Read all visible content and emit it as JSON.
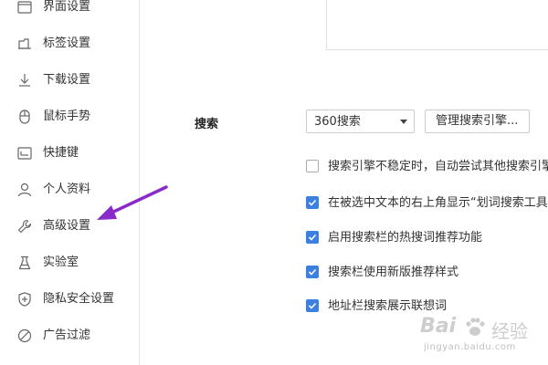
{
  "sidebar": {
    "items": [
      {
        "label": "界面设置",
        "icon": "window-icon"
      },
      {
        "label": "标签设置",
        "icon": "tab-icon"
      },
      {
        "label": "下载设置",
        "icon": "download-icon"
      },
      {
        "label": "鼠标手势",
        "icon": "mouse-icon"
      },
      {
        "label": "快捷键",
        "icon": "keyboard-icon"
      },
      {
        "label": "个人资料",
        "icon": "person-icon"
      },
      {
        "label": "高级设置",
        "icon": "wrench-icon"
      },
      {
        "label": "实验室",
        "icon": "flask-icon"
      },
      {
        "label": "隐私安全设置",
        "icon": "shield-plus-icon"
      },
      {
        "label": "广告过滤",
        "icon": "block-icon"
      }
    ]
  },
  "search": {
    "section_label": "搜索",
    "engine_value": "360搜索",
    "manage_button": "管理搜索引擎...",
    "options": [
      {
        "label": "搜索引擎不稳定时，自动尝试其他搜索引擎",
        "checked": false
      },
      {
        "label": "在被选中文本的右上角显示“划词搜索工具条”",
        "checked": true
      },
      {
        "label": "启用搜索栏的热搜词推荐功能",
        "checked": true
      },
      {
        "label": "搜索栏使用新版推荐样式",
        "checked": true
      },
      {
        "label": "地址栏搜索展示联想词",
        "checked": true
      }
    ]
  },
  "annotation": {
    "color": "#8a2bc9"
  },
  "watermark": {
    "logo": "Bai",
    "suffix": "经验",
    "url": "jingyan.baidu.com"
  },
  "colors": {
    "checkbox_checked": "#3b7fe0"
  }
}
